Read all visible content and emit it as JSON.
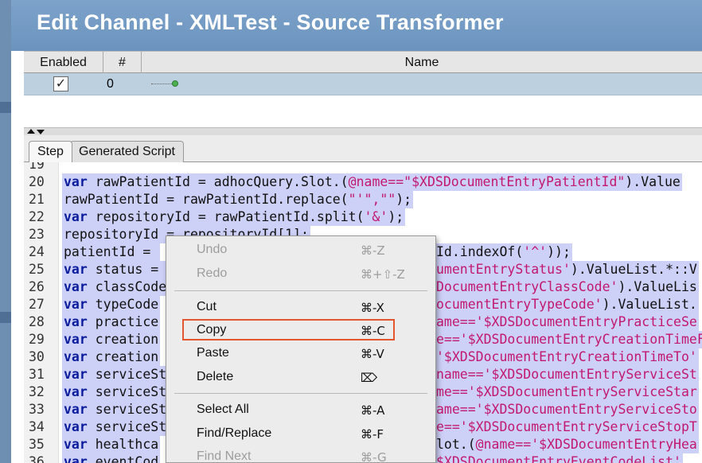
{
  "window": {
    "title": "Edit Channel - XMLTest - Source Transformer"
  },
  "table": {
    "headers": [
      "Enabled",
      "#",
      "Name"
    ],
    "rows": [
      {
        "enabled": "✓",
        "number": "0",
        "name": ""
      }
    ]
  },
  "tabs": [
    "Step",
    "Generated Script"
  ],
  "editor": {
    "lines": [
      {
        "n": "19",
        "parts": []
      },
      {
        "n": "20",
        "parts": [
          [
            "kw",
            "var"
          ],
          [
            "p",
            " rawPatientId = adhocQuery.Slot.("
          ],
          [
            "s",
            "@name==\"$XDSDocumentEntryPatientId\""
          ],
          [
            "p",
            ").Value"
          ]
        ]
      },
      {
        "n": "21",
        "parts": [
          [
            "p",
            "rawPatientId = rawPatientId.replace("
          ],
          [
            "s",
            "\"'\",\"\""
          ],
          [
            "p",
            ");"
          ]
        ]
      },
      {
        "n": "22",
        "parts": [
          [
            "kw",
            "var"
          ],
          [
            "p",
            " repositoryId = rawPatientId.split("
          ],
          [
            "s",
            "'&'"
          ],
          [
            "p",
            ");"
          ]
        ]
      },
      {
        "n": "23",
        "parts": [
          [
            "p",
            "repositoryId = repositoryId[1];"
          ]
        ]
      },
      {
        "n": "24",
        "parts": [
          [
            "p",
            "patientId = "
          ]
        ],
        "tail": [
          [
            "p",
            "Id.indexOf("
          ],
          [
            "s",
            "'^'"
          ],
          [
            "p",
            "));"
          ]
        ]
      },
      {
        "n": "25",
        "parts": [
          [
            "kw",
            "var"
          ],
          [
            "p",
            " status = "
          ]
        ],
        "tail": [
          [
            "s",
            "umentEntryStatus'"
          ],
          [
            "p",
            ").ValueList.*::V"
          ]
        ]
      },
      {
        "n": "26",
        "parts": [
          [
            "kw",
            "var"
          ],
          [
            "p",
            " classCode"
          ]
        ],
        "tail": [
          [
            "s",
            "DocumentEntryClassCode'"
          ],
          [
            "p",
            ").ValueLis"
          ]
        ]
      },
      {
        "n": "27",
        "parts": [
          [
            "kw",
            "var"
          ],
          [
            "p",
            " typeCode"
          ]
        ],
        "tail": [
          [
            "s",
            "ocumentEntryTypeCode'"
          ],
          [
            "p",
            ").ValueList."
          ]
        ]
      },
      {
        "n": "28",
        "parts": [
          [
            "kw",
            "var"
          ],
          [
            "p",
            " practice"
          ]
        ],
        "tail": [
          [
            "s",
            "ame=='$XDSDocumentEntryPracticeSe"
          ]
        ]
      },
      {
        "n": "29",
        "parts": [
          [
            "kw",
            "var"
          ],
          [
            "p",
            " creation"
          ]
        ],
        "tail": [
          [
            "s",
            "e=='$XDSDocumentEntryCreationTimeF"
          ]
        ]
      },
      {
        "n": "30",
        "parts": [
          [
            "kw",
            "var"
          ],
          [
            "p",
            " creation"
          ]
        ],
        "tail": [
          [
            "s",
            "'$XDSDocumentEntryCreationTimeTo'"
          ]
        ]
      },
      {
        "n": "31",
        "parts": [
          [
            "kw",
            "var"
          ],
          [
            "p",
            " serviceSt"
          ]
        ],
        "tail": [
          [
            "s",
            "name=='$XDSDocumentEntryServiceSt"
          ]
        ]
      },
      {
        "n": "32",
        "parts": [
          [
            "kw",
            "var"
          ],
          [
            "p",
            " serviceSt"
          ]
        ],
        "tail": [
          [
            "s",
            "me=='$XDSDocumentEntryServiceStar"
          ]
        ]
      },
      {
        "n": "33",
        "parts": [
          [
            "kw",
            "var"
          ],
          [
            "p",
            " serviceSt"
          ]
        ],
        "tail": [
          [
            "s",
            "ame=='$XDSDocumentEntryServiceSto"
          ]
        ]
      },
      {
        "n": "34",
        "parts": [
          [
            "kw",
            "var"
          ],
          [
            "p",
            " serviceSt"
          ]
        ],
        "tail": [
          [
            "s",
            "e=='$XDSDocumentEntryServiceStopT"
          ]
        ]
      },
      {
        "n": "35",
        "parts": [
          [
            "kw",
            "var"
          ],
          [
            "p",
            " healthca"
          ]
        ],
        "tail": [
          [
            "p",
            "lot.("
          ],
          [
            "s",
            "@name=='$XDSDocumentEntryHea"
          ]
        ]
      },
      {
        "n": "36",
        "parts": [
          [
            "kw",
            "var"
          ],
          [
            "p",
            " eventCod"
          ]
        ],
        "tail": [
          [
            "s",
            "$XDSDocumentEntryEventCodeList'"
          ]
        ]
      }
    ]
  },
  "context_menu": {
    "items": [
      {
        "label": "Undo",
        "shortcut": "⌘-Z",
        "enabled": false
      },
      {
        "label": "Redo",
        "shortcut": "⌘+⇧-Z",
        "enabled": false
      },
      {
        "label": "Cut",
        "shortcut": "⌘-X",
        "enabled": true
      },
      {
        "label": "Copy",
        "shortcut": "⌘-C",
        "enabled": true,
        "highlighted": true
      },
      {
        "label": "Paste",
        "shortcut": "⌘-V",
        "enabled": true
      },
      {
        "label": "Delete",
        "shortcut": "⌦",
        "enabled": true
      },
      {
        "label": "Select All",
        "shortcut": "⌘-A",
        "enabled": true
      },
      {
        "label": "Find/Replace",
        "shortcut": "⌘-F",
        "enabled": true
      },
      {
        "label": "Find Next",
        "shortcut": "⌘-G",
        "enabled": false
      }
    ]
  },
  "colors": {
    "title_bar": "#6b93bd",
    "keyword": "#0b1c9c",
    "string": "#c2186f",
    "selection": "#cdd0f7",
    "highlight_box": "#e4572e"
  }
}
